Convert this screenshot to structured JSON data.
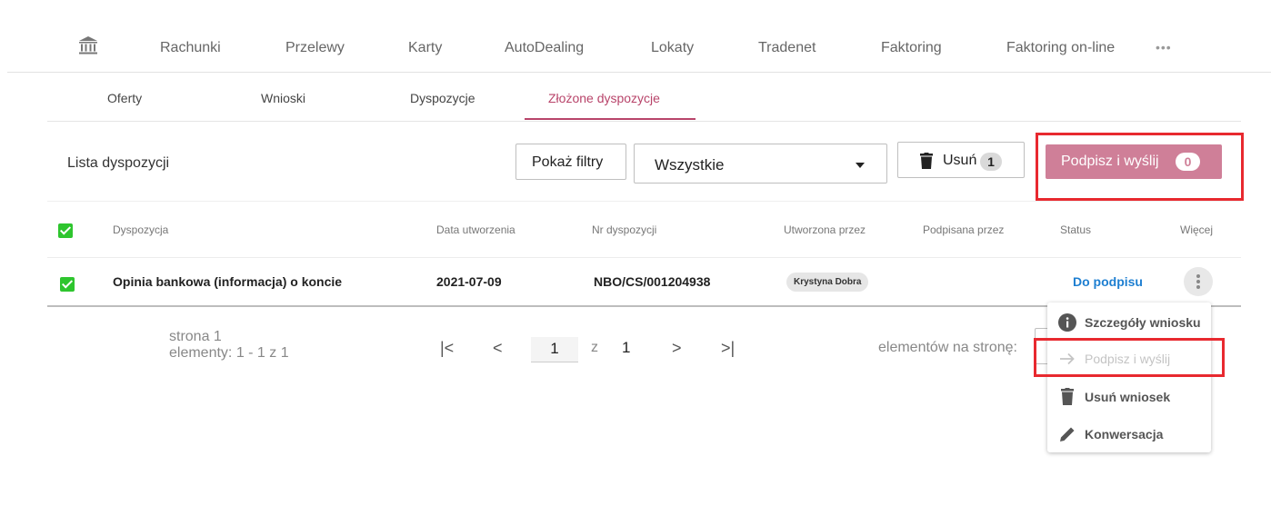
{
  "topnav": {
    "items": [
      "Rachunki",
      "Przelewy",
      "Karty",
      "AutoDealing",
      "Lokaty",
      "Tradenet",
      "Faktoring",
      "Faktoring on-line"
    ],
    "more": "•••"
  },
  "subtabs": [
    "Oferty",
    "Wnioski",
    "Dyspozycje",
    "Złożone dyspozycje"
  ],
  "toolbar": {
    "title": "Lista dyspozycji",
    "filters_label": "Pokaż filtry",
    "select_value": "Wszystkie",
    "delete_label": "Usuń",
    "delete_count": "1",
    "sign_label": "Podpisz i wyślij",
    "sign_count": "0"
  },
  "table": {
    "headers": [
      "Dyspozycja",
      "Data utworzenia",
      "Nr dyspozycji",
      "Utworzona przez",
      "Podpisana przez",
      "Status",
      "Więcej"
    ],
    "rows": [
      {
        "dyspozycja": "Opinia bankowa (informacja) o koncie",
        "data": "2021-07-09",
        "nr": "NBO/CS/001204938",
        "utworzona": "Krystyna Dobra",
        "podpisana": "",
        "status": "Do podpisu"
      }
    ]
  },
  "pagination": {
    "page_label": "strona 1",
    "elements_label": "elementy: 1 - 1 z 1",
    "first": "|<",
    "prev": "<",
    "current": "1",
    "of": "z",
    "total": "1",
    "next": ">",
    "last": ">|",
    "per_page_label": "elementów na stronę:"
  },
  "menu": {
    "items": [
      {
        "label": "Szczegóły wniosku",
        "icon": "info-icon"
      },
      {
        "label": "Podpisz i wyślij",
        "icon": "arrow-right-icon"
      },
      {
        "label": "Usuń wniosek",
        "icon": "trash-icon"
      },
      {
        "label": "Konwersacja",
        "icon": "pencil-icon"
      }
    ]
  },
  "colors": {
    "accent": "#b8446a",
    "sign_button": "#cf7f98",
    "status_link": "#1e7fd1",
    "checkbox": "#2ec52e",
    "highlight": "#e8292f"
  }
}
